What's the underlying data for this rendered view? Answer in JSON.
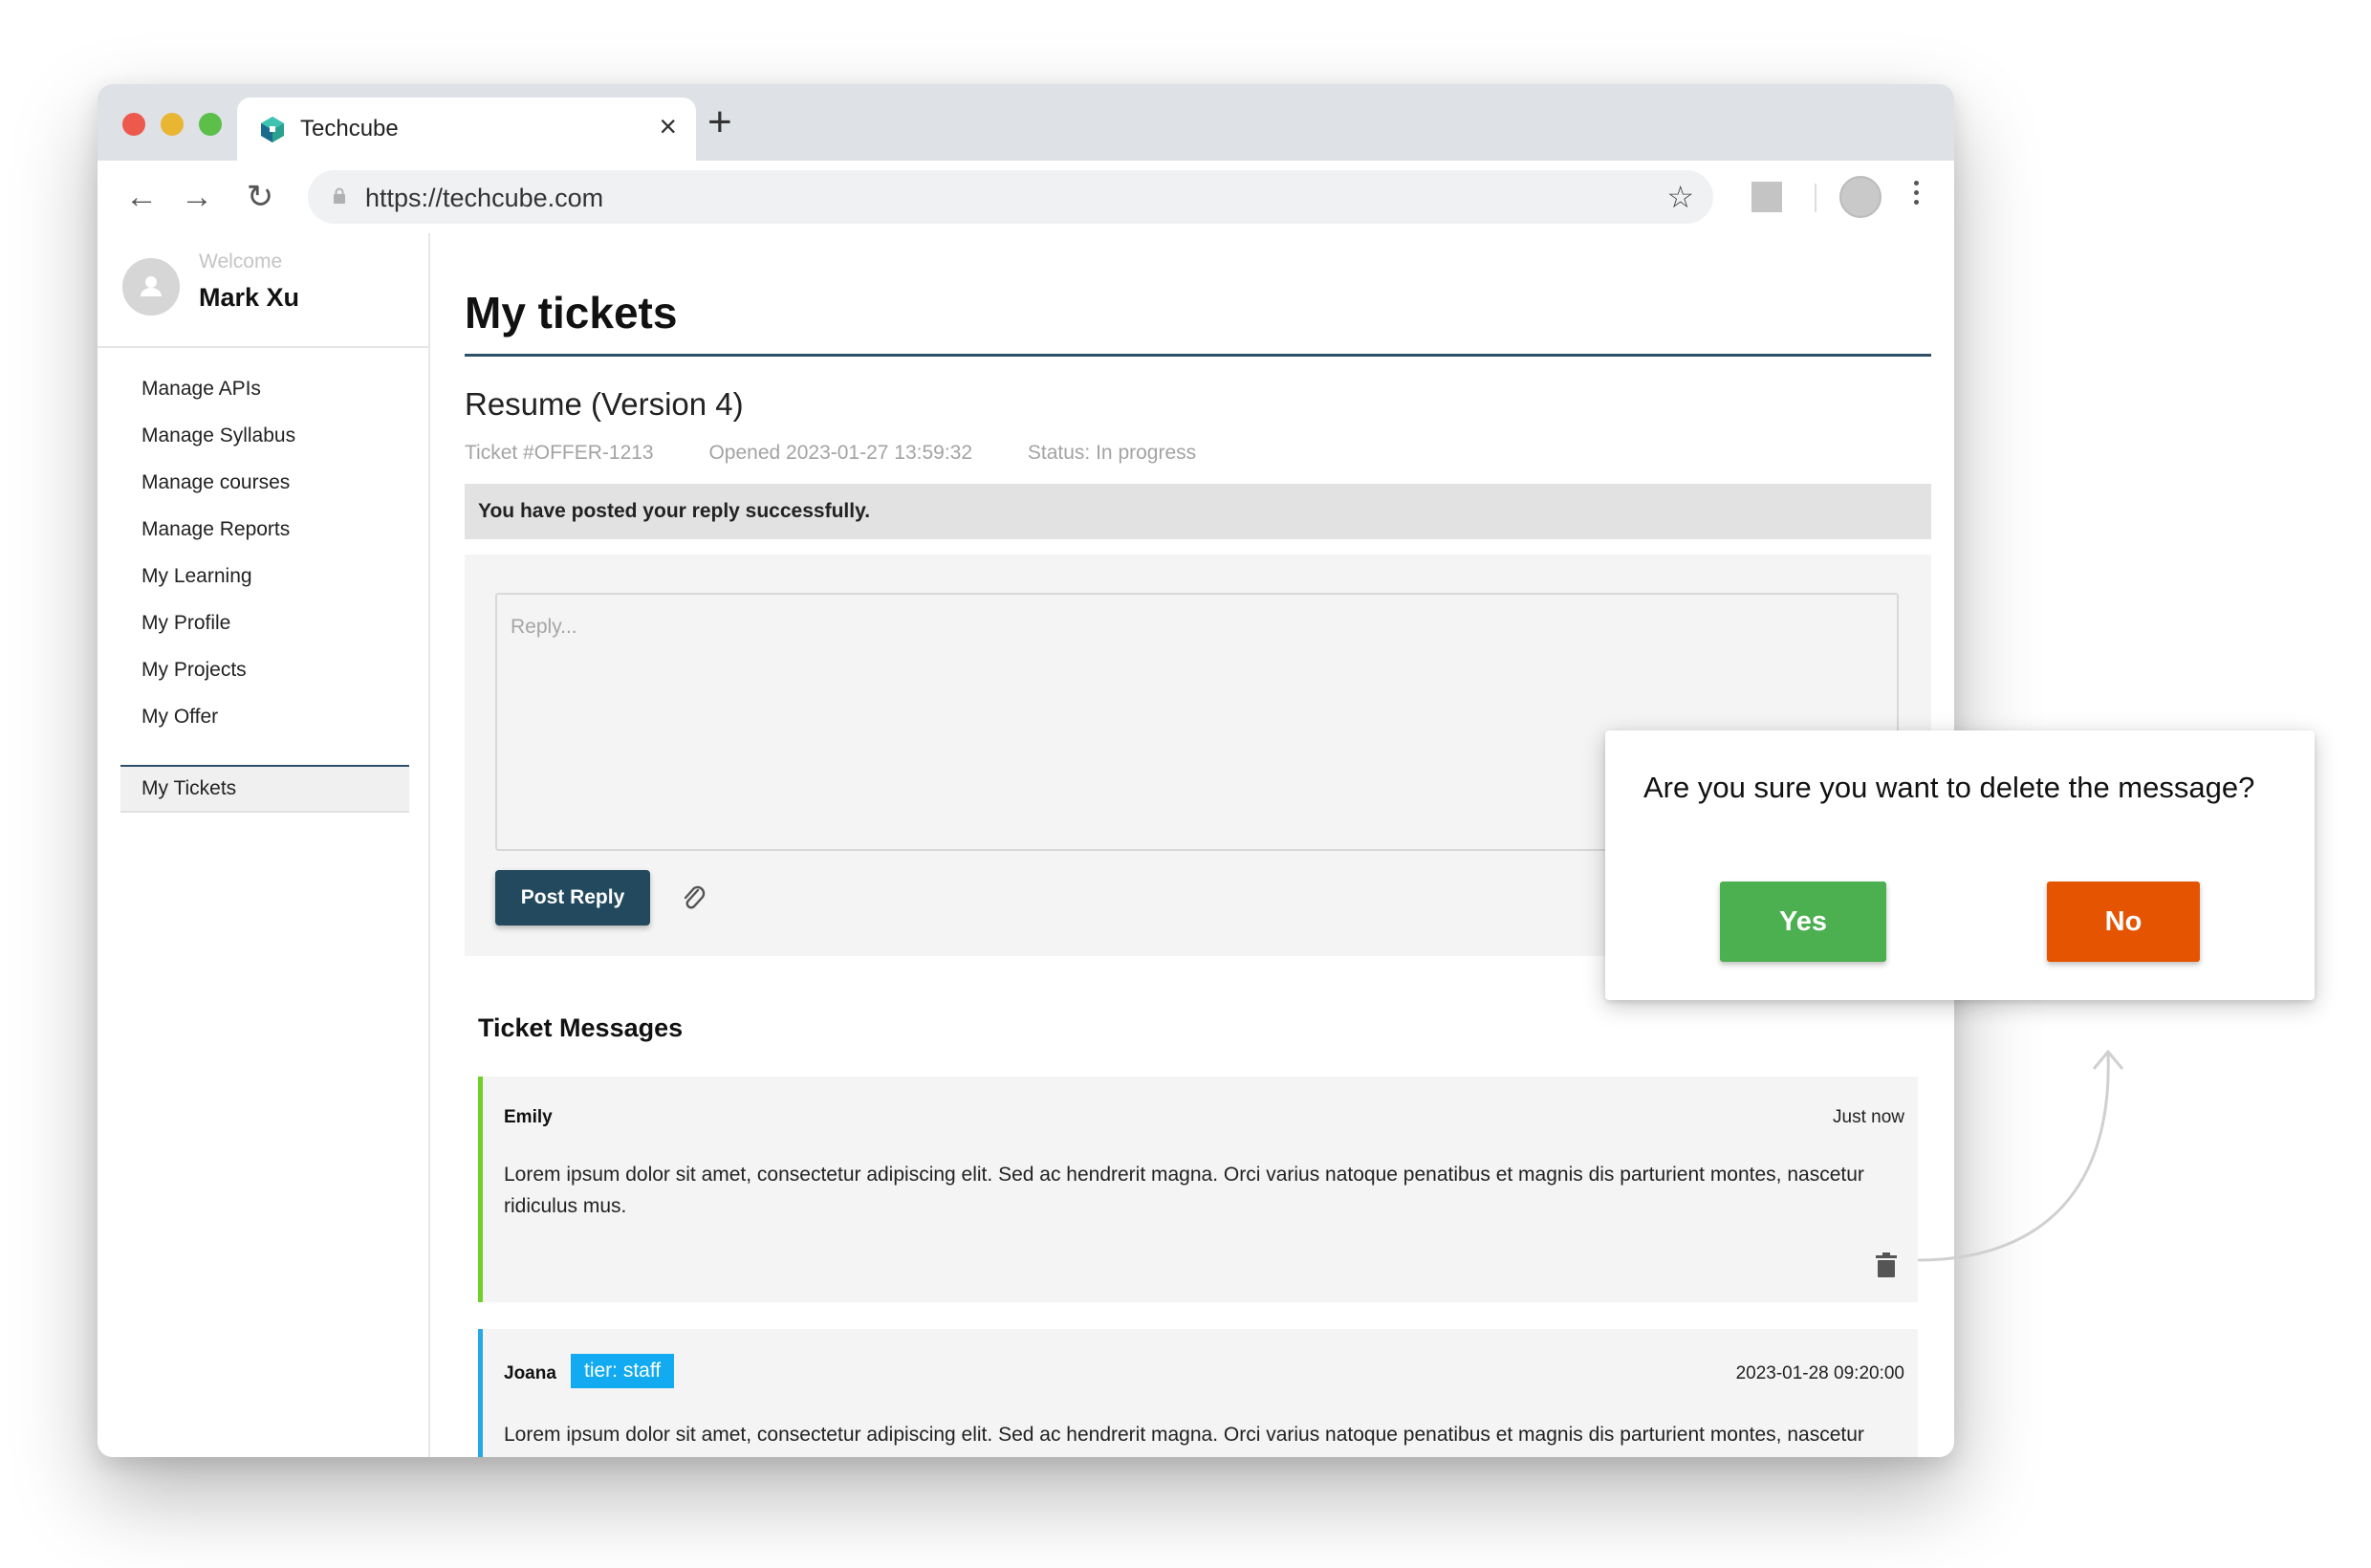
{
  "browser": {
    "tab_title": "Techcube",
    "url": "https://techcube.com"
  },
  "sidebar": {
    "welcome": "Welcome",
    "username": "Mark Xu",
    "items": [
      {
        "label": "Manage APIs"
      },
      {
        "label": "Manage Syllabus"
      },
      {
        "label": "Manage courses"
      },
      {
        "label": "Manage Reports"
      },
      {
        "label": "My Learning"
      },
      {
        "label": "My Profile"
      },
      {
        "label": "My Projects"
      },
      {
        "label": "My Offer"
      }
    ],
    "active_item": "My Tickets"
  },
  "main": {
    "page_title": "My tickets",
    "ticket_title": "Resume (Version 4)",
    "ticket_id": "Ticket #OFFER-1213",
    "opened": "Opened 2023-01-27 13:59:32",
    "status": "Status: In progress",
    "success_message": "You have posted your reply successfully.",
    "reply_placeholder": "Reply...",
    "post_reply_label": "Post Reply",
    "messages_heading": "Ticket Messages",
    "messages": [
      {
        "author": "Emily",
        "time": "Just now",
        "body": "Lorem ipsum dolor sit amet, consectetur adipiscing elit. Sed ac hendrerit magna. Orci varius natoque penatibus et magnis dis parturient montes, nascetur ridiculus mus."
      },
      {
        "author": "Joana",
        "badge": "tier: staff",
        "time": "2023-01-28  09:20:00",
        "body": "Lorem ipsum dolor sit amet, consectetur adipiscing elit. Sed ac hendrerit magna. Orci varius natoque penatibus et magnis dis parturient montes, nascetur ridiculus mus. Nulla facilisi. Fusce non magna egestas, pulvinar ipsum eget, tempus ligula. Pellentesque vivamus turpis finibus vel volutpat."
      }
    ]
  },
  "dialog": {
    "question": "Are you sure you want to delete the message?",
    "yes_label": "Yes",
    "no_label": "No"
  },
  "colors": {
    "accent": "#22495e",
    "yes": "#4caf50",
    "no": "#e55400",
    "emily_bar": "#6fd02c",
    "staff_bar": "#29a8e8",
    "badge": "#12aaf0"
  }
}
